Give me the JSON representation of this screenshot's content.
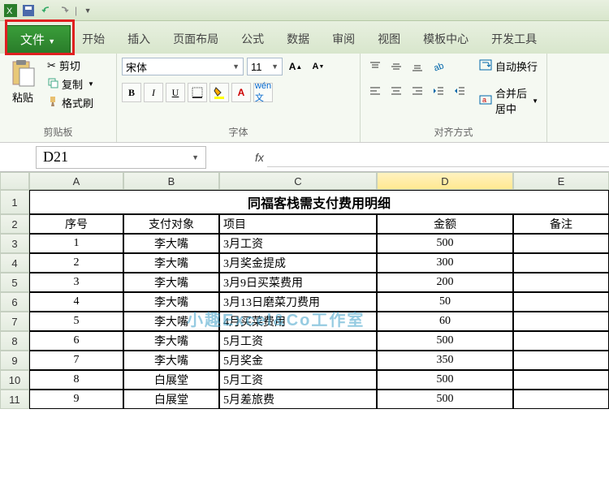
{
  "qat": {
    "save": "save",
    "undo": "undo",
    "redo": "redo"
  },
  "tabs": {
    "file": "文件",
    "items": [
      "开始",
      "插入",
      "页面布局",
      "公式",
      "数据",
      "审阅",
      "视图",
      "模板中心",
      "开发工具"
    ]
  },
  "ribbon": {
    "clipboard": {
      "paste": "粘贴",
      "cut": "剪切",
      "copy": "复制",
      "format_painter": "格式刷",
      "label": "剪贴板"
    },
    "font": {
      "name": "宋体",
      "size": "11",
      "bold": "B",
      "italic": "I",
      "underline": "U",
      "label": "字体"
    },
    "align": {
      "wrap": "自动换行",
      "merge": "合并后居中",
      "label": "对齐方式"
    }
  },
  "namebox": "D21",
  "fx": "fx",
  "columns": [
    "A",
    "B",
    "C",
    "D",
    "E"
  ],
  "title": "同福客栈需支付费用明细",
  "headers": [
    "序号",
    "支付对象",
    "项目",
    "金额",
    "备注"
  ],
  "rows": [
    {
      "n": "1",
      "payee": "李大嘴",
      "item": "3月工资",
      "amt": "500",
      "note": ""
    },
    {
      "n": "2",
      "payee": "李大嘴",
      "item": "3月奖金提成",
      "amt": "300",
      "note": ""
    },
    {
      "n": "3",
      "payee": "李大嘴",
      "item": "3月9日买菜费用",
      "amt": "200",
      "note": ""
    },
    {
      "n": "4",
      "payee": "李大嘴",
      "item": "3月13日磨菜刀费用",
      "amt": "50",
      "note": ""
    },
    {
      "n": "5",
      "payee": "李大嘴",
      "item": "4月买菜费用",
      "amt": "60",
      "note": ""
    },
    {
      "n": "6",
      "payee": "李大嘴",
      "item": "5月工资",
      "amt": "500",
      "note": ""
    },
    {
      "n": "7",
      "payee": "李大嘴",
      "item": "5月奖金",
      "amt": "350",
      "note": ""
    },
    {
      "n": "8",
      "payee": "白展堂",
      "item": "5月工资",
      "amt": "500",
      "note": ""
    },
    {
      "n": "9",
      "payee": "白展堂",
      "item": "5月差旅费",
      "amt": "500",
      "note": ""
    }
  ],
  "watermark": "小趣Excel&Co工作室"
}
